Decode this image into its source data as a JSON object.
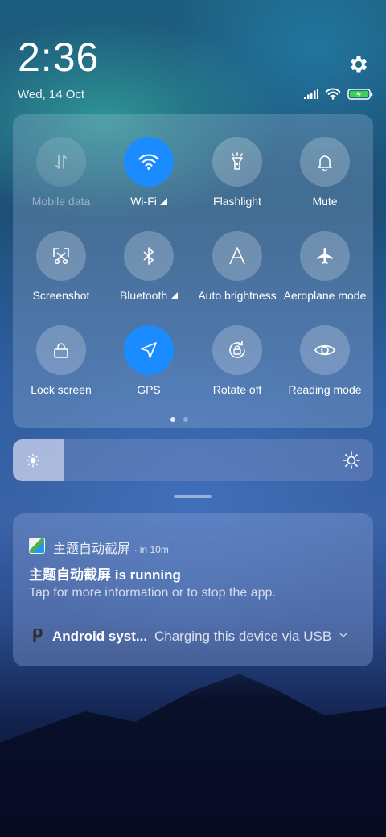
{
  "status": {
    "time": "2:36",
    "date": "Wed, 14 Oct"
  },
  "tiles": [
    {
      "label": "Mobile data",
      "active": false,
      "enabled": false,
      "icon": "mobile-data-icon"
    },
    {
      "label": "Wi-Fi",
      "active": true,
      "enabled": true,
      "icon": "wifi-icon"
    },
    {
      "label": "Flashlight",
      "active": false,
      "enabled": true,
      "icon": "flashlight-icon"
    },
    {
      "label": "Mute",
      "active": false,
      "enabled": true,
      "icon": "bell-icon"
    },
    {
      "label": "Screenshot",
      "active": false,
      "enabled": true,
      "icon": "screenshot-icon"
    },
    {
      "label": "Bluetooth",
      "active": false,
      "enabled": true,
      "icon": "bluetooth-icon"
    },
    {
      "label": "Auto brightness",
      "active": false,
      "enabled": true,
      "icon": "auto-brightness-icon"
    },
    {
      "label": "Aeroplane mode",
      "active": false,
      "enabled": true,
      "icon": "airplane-icon"
    },
    {
      "label": "Lock screen",
      "active": false,
      "enabled": true,
      "icon": "lock-icon"
    },
    {
      "label": "GPS",
      "active": true,
      "enabled": true,
      "icon": "gps-icon"
    },
    {
      "label": "Rotate off",
      "active": false,
      "enabled": true,
      "icon": "rotate-lock-icon"
    },
    {
      "label": "Reading mode",
      "active": false,
      "enabled": true,
      "icon": "eye-icon"
    }
  ],
  "brightness_level": 0.14,
  "colors": {
    "accent": "#1a8cff"
  },
  "notification": {
    "app_name": "主题自动截屏",
    "time": "· in 10m",
    "title": "主题自动截屏 is running",
    "text": "Tap for more information or to stop the app."
  },
  "system_notification": {
    "app": "Android syst...",
    "text": "Charging this device via USB"
  }
}
